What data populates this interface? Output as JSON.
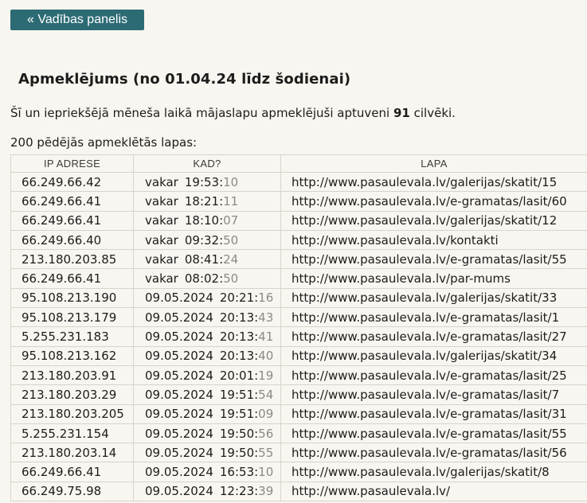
{
  "nav": {
    "back_label": "« Vadības panelis"
  },
  "heading": "Apmeklējums (no 01.04.24 līdz šodienai)",
  "summary": {
    "prefix": "Šī un iepriekšējā mēneša laikā mājaslapu apmeklējuši aptuveni",
    "count": "91",
    "suffix": "cilvēki."
  },
  "list_label": "200 pēdējās apmeklētās lapas:",
  "table": {
    "headers": {
      "ip": "IP ADRESE",
      "when": "KAD?",
      "page": "LAPA"
    },
    "rows": [
      {
        "ip": "66.249.66.42",
        "day": "vakar",
        "time": "19:53:",
        "sec": "10",
        "page": "http://www.pasaulevala.lv/galerijas/skatit/15"
      },
      {
        "ip": "66.249.66.41",
        "day": "vakar",
        "time": "18:21:",
        "sec": "11",
        "page": "http://www.pasaulevala.lv/e-gramatas/lasit/60"
      },
      {
        "ip": "66.249.66.41",
        "day": "vakar",
        "time": "18:10:",
        "sec": "07",
        "page": "http://www.pasaulevala.lv/galerijas/skatit/12"
      },
      {
        "ip": "66.249.66.40",
        "day": "vakar",
        "time": "09:32:",
        "sec": "50",
        "page": "http://www.pasaulevala.lv/kontakti"
      },
      {
        "ip": "213.180.203.85",
        "day": "vakar",
        "time": "08:41:",
        "sec": "24",
        "page": "http://www.pasaulevala.lv/e-gramatas/lasit/55"
      },
      {
        "ip": "66.249.66.41",
        "day": "vakar",
        "time": "08:02:",
        "sec": "50",
        "page": "http://www.pasaulevala.lv/par-mums"
      },
      {
        "ip": "95.108.213.190",
        "day": "09.05.2024",
        "time": "20:21:",
        "sec": "16",
        "page": "http://www.pasaulevala.lv/galerijas/skatit/33"
      },
      {
        "ip": "95.108.213.179",
        "day": "09.05.2024",
        "time": "20:13:",
        "sec": "43",
        "page": "http://www.pasaulevala.lv/e-gramatas/lasit/1"
      },
      {
        "ip": "5.255.231.183",
        "day": "09.05.2024",
        "time": "20:13:",
        "sec": "41",
        "page": "http://www.pasaulevala.lv/e-gramatas/lasit/27"
      },
      {
        "ip": "95.108.213.162",
        "day": "09.05.2024",
        "time": "20:13:",
        "sec": "40",
        "page": "http://www.pasaulevala.lv/galerijas/skatit/34"
      },
      {
        "ip": "213.180.203.91",
        "day": "09.05.2024",
        "time": "20:01:",
        "sec": "19",
        "page": "http://www.pasaulevala.lv/e-gramatas/lasit/25"
      },
      {
        "ip": "213.180.203.29",
        "day": "09.05.2024",
        "time": "19:51:",
        "sec": "54",
        "page": "http://www.pasaulevala.lv/e-gramatas/lasit/7"
      },
      {
        "ip": "213.180.203.205",
        "day": "09.05.2024",
        "time": "19:51:",
        "sec": "09",
        "page": "http://www.pasaulevala.lv/e-gramatas/lasit/31"
      },
      {
        "ip": "5.255.231.154",
        "day": "09.05.2024",
        "time": "19:50:",
        "sec": "56",
        "page": "http://www.pasaulevala.lv/e-gramatas/lasit/55"
      },
      {
        "ip": "213.180.203.14",
        "day": "09.05.2024",
        "time": "19:50:",
        "sec": "55",
        "page": "http://www.pasaulevala.lv/e-gramatas/lasit/56"
      },
      {
        "ip": "66.249.66.41",
        "day": "09.05.2024",
        "time": "16:53:",
        "sec": "10",
        "page": "http://www.pasaulevala.lv/galerijas/skatit/8"
      },
      {
        "ip": "66.249.75.98",
        "day": "09.05.2024",
        "time": "12:23:",
        "sec": "39",
        "page": "http://www.pasaulevala.lv/"
      }
    ]
  },
  "colors": {
    "button_bg": "#2d6b74",
    "page_bg": "#f8f6f0",
    "seconds_text": "#8a8a8a",
    "border": "#d8d4cc"
  }
}
